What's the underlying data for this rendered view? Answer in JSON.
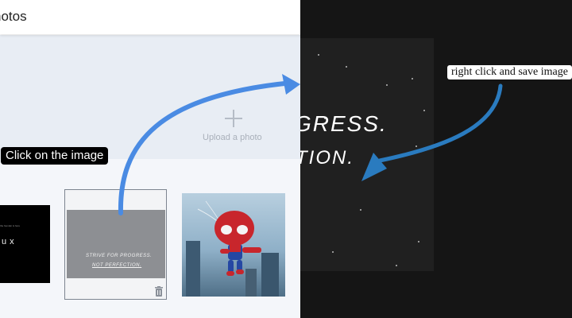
{
  "header": {
    "title": "hotos"
  },
  "upload": {
    "label": "Upload a photo"
  },
  "gallery": {
    "dark_thumb": {
      "tiny_text": "the founder is here",
      "text": "ux"
    },
    "selected_thumb": {
      "line1": "STRIVE FOR PROGRESS.",
      "line2": "NOT PERFECTION."
    }
  },
  "viewer": {
    "line1": "GRESS.",
    "line2": "TION."
  },
  "annotations": {
    "tooltip": "Click on the image",
    "hint": "right click and save image"
  },
  "colors": {
    "arrow_blue": "#4a8be3",
    "arrow_dark_blue": "#2a7bbf",
    "upload_bg": "#e8edf4",
    "viewer_bg": "#151515"
  }
}
